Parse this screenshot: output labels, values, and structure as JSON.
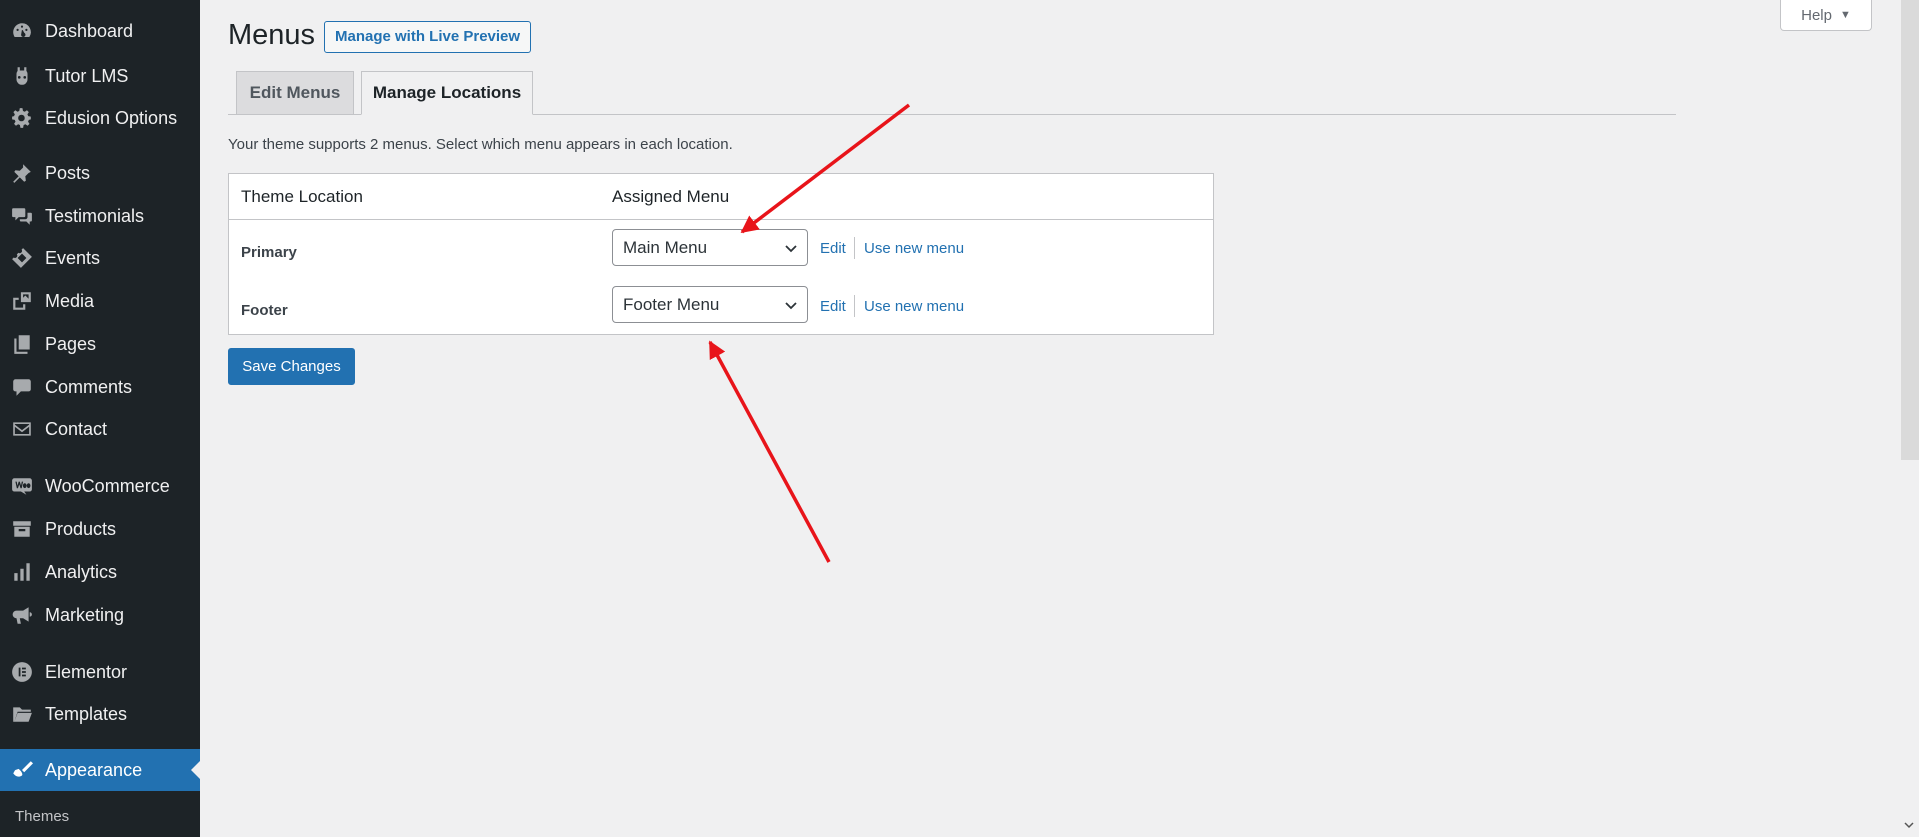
{
  "sidebar": {
    "items": [
      {
        "label": "Dashboard",
        "icon": "dashboard-icon"
      },
      {
        "label": "Tutor LMS",
        "icon": "tutor-icon"
      },
      {
        "label": "Edusion Options",
        "icon": "gear-icon"
      },
      {
        "label": "Posts",
        "icon": "pin-icon"
      },
      {
        "label": "Testimonials",
        "icon": "chat-icon"
      },
      {
        "label": "Events",
        "icon": "ticket-icon"
      },
      {
        "label": "Media",
        "icon": "media-icon"
      },
      {
        "label": "Pages",
        "icon": "pages-icon"
      },
      {
        "label": "Comments",
        "icon": "comment-icon"
      },
      {
        "label": "Contact",
        "icon": "mail-icon"
      },
      {
        "label": "WooCommerce",
        "icon": "woo-icon"
      },
      {
        "label": "Products",
        "icon": "archive-icon"
      },
      {
        "label": "Analytics",
        "icon": "bar-chart-icon"
      },
      {
        "label": "Marketing",
        "icon": "megaphone-icon"
      },
      {
        "label": "Elementor",
        "icon": "elementor-icon"
      },
      {
        "label": "Templates",
        "icon": "folder-icon"
      },
      {
        "label": "Appearance",
        "icon": "brush-icon",
        "active": true
      }
    ],
    "submenu": {
      "label": "Themes"
    }
  },
  "header": {
    "title": "Menus",
    "live_preview_label": "Manage with Live Preview",
    "help_label": "Help"
  },
  "tabs": [
    {
      "label": "Edit Menus",
      "active": false
    },
    {
      "label": "Manage Locations",
      "active": true
    }
  ],
  "intro_text": "Your theme supports 2 menus. Select which menu appears in each location.",
  "table": {
    "columns": [
      "Theme Location",
      "Assigned Menu"
    ],
    "rows": [
      {
        "location": "Primary",
        "selected_menu": "Main Menu",
        "edit_label": "Edit",
        "new_label": "Use new menu"
      },
      {
        "location": "Footer",
        "selected_menu": "Footer Menu",
        "edit_label": "Edit",
        "new_label": "Use new menu"
      }
    ]
  },
  "save_label": "Save Changes",
  "colors": {
    "sidebar_bg": "#1d2327",
    "accent": "#2271b1",
    "page_bg": "#f0f0f1",
    "annotation_arrow": "#e8141a"
  }
}
